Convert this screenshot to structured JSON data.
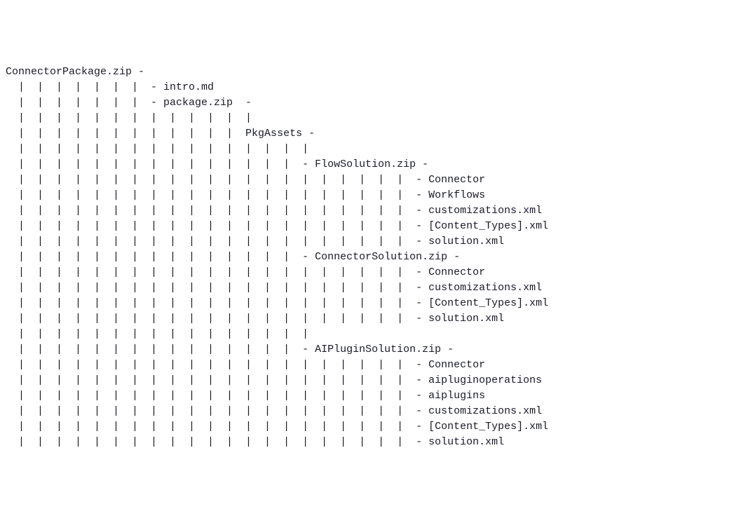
{
  "tree": {
    "root": {
      "name": "ConnectorPackage.zip",
      "dash_after": "-",
      "children": [
        {
          "name": "intro.md"
        },
        {
          "name": "package.zip",
          "dash_after": "-",
          "children": [
            {
              "name": "PkgAssets",
              "dash_after": "-",
              "children": [
                {
                  "name": "FlowSolution.zip",
                  "dash_after": "-",
                  "children": [
                    {
                      "name": "Connector"
                    },
                    {
                      "name": "Workflows"
                    },
                    {
                      "name": "customizations.xml"
                    },
                    {
                      "name": "[Content_Types].xml"
                    },
                    {
                      "name": "solution.xml"
                    }
                  ]
                },
                {
                  "name": "ConnectorSolution.zip",
                  "dash_after": "-",
                  "children": [
                    {
                      "name": "Connector"
                    },
                    {
                      "name": "customizations.xml"
                    },
                    {
                      "name": "[Content_Types].xml"
                    },
                    {
                      "name": "solution.xml"
                    }
                  ]
                },
                {
                  "name": "AIPluginSolution.zip",
                  "dash_after": "-",
                  "children": [
                    {
                      "name": "Connector"
                    },
                    {
                      "name": "aipluginoperations"
                    },
                    {
                      "name": "aiplugins"
                    },
                    {
                      "name": "customizations.xml"
                    },
                    {
                      "name": "[Content_Types].xml"
                    },
                    {
                      "name": "solution.xml"
                    }
                  ]
                }
              ]
            }
          ]
        }
      ]
    }
  },
  "lines": [
    {
      "text": "ConnectorPackage.zip -"
    },
    {
      "text": "  |  |  |  |  |  |  |  - intro.md"
    },
    {
      "text": "  |  |  |  |  |  |  |  - package.zip  -"
    },
    {
      "text": "  |  |  |  |  |  |  |  |  |  |  |  |  |"
    },
    {
      "text": "  |  |  |  |  |  |  |  |  |  |  |  |  PkgAssets -"
    },
    {
      "text": "  |  |  |  |  |  |  |  |  |  |  |  |  |  |  |  |"
    },
    {
      "text": "  |  |  |  |  |  |  |  |  |  |  |  |  |  |  |  - FlowSolution.zip -"
    },
    {
      "text": "  |  |  |  |  |  |  |  |  |  |  |  |  |  |  |  |  |  |  |  |  |  - Connector"
    },
    {
      "text": "  |  |  |  |  |  |  |  |  |  |  |  |  |  |  |  |  |  |  |  |  |  - Workflows"
    },
    {
      "text": "  |  |  |  |  |  |  |  |  |  |  |  |  |  |  |  |  |  |  |  |  |  - customizations.xml"
    },
    {
      "text": "  |  |  |  |  |  |  |  |  |  |  |  |  |  |  |  |  |  |  |  |  |  - [Content_Types].xml"
    },
    {
      "text": "  |  |  |  |  |  |  |  |  |  |  |  |  |  |  |  |  |  |  |  |  |  - solution.xml"
    },
    {
      "text": "  |  |  |  |  |  |  |  |  |  |  |  |  |  |  |  - ConnectorSolution.zip -"
    },
    {
      "text": "  |  |  |  |  |  |  |  |  |  |  |  |  |  |  |  |  |  |  |  |  |  - Connector"
    },
    {
      "text": "  |  |  |  |  |  |  |  |  |  |  |  |  |  |  |  |  |  |  |  |  |  - customizations.xml"
    },
    {
      "text": "  |  |  |  |  |  |  |  |  |  |  |  |  |  |  |  |  |  |  |  |  |  - [Content_Types].xml"
    },
    {
      "text": "  |  |  |  |  |  |  |  |  |  |  |  |  |  |  |  |  |  |  |  |  |  - solution.xml"
    },
    {
      "text": "  |  |  |  |  |  |  |  |  |  |  |  |  |  |  |  |"
    },
    {
      "text": "  |  |  |  |  |  |  |  |  |  |  |  |  |  |  |  - AIPluginSolution.zip -"
    },
    {
      "text": "  |  |  |  |  |  |  |  |  |  |  |  |  |  |  |  |  |  |  |  |  |  - Connector"
    },
    {
      "text": "  |  |  |  |  |  |  |  |  |  |  |  |  |  |  |  |  |  |  |  |  |  - aipluginoperations"
    },
    {
      "text": "  |  |  |  |  |  |  |  |  |  |  |  |  |  |  |  |  |  |  |  |  |  - aiplugins"
    },
    {
      "text": "  |  |  |  |  |  |  |  |  |  |  |  |  |  |  |  |  |  |  |  |  |  - customizations.xml"
    },
    {
      "text": "  |  |  |  |  |  |  |  |  |  |  |  |  |  |  |  |  |  |  |  |  |  - [Content_Types].xml"
    },
    {
      "text": "  |  |  |  |  |  |  |  |  |  |  |  |  |  |  |  |  |  |  |  |  |  - solution.xml"
    }
  ]
}
